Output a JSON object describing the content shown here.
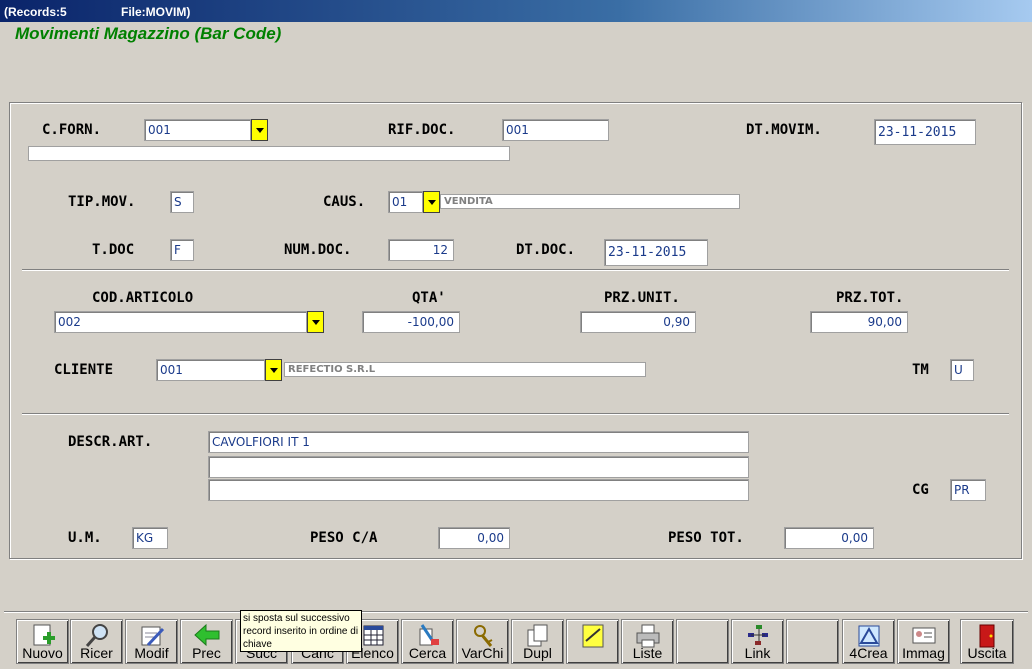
{
  "titlebar": {
    "records": "(Records:5",
    "file": "File:MOVIM)"
  },
  "form": {
    "title": "Movimenti Magazzino (Bar Code)"
  },
  "fields": {
    "c_forn": {
      "label": "C.FORN.",
      "value": "001",
      "desc": ""
    },
    "rif_doc": {
      "label": "RIF.DOC.",
      "value": "001"
    },
    "dt_movim": {
      "label": "DT.MOVIM.",
      "value": "23-11-2015"
    },
    "tip_mov": {
      "label": "TIP.MOV.",
      "value": "S"
    },
    "caus": {
      "label": "CAUS.",
      "value": "01",
      "desc": "VENDITA"
    },
    "t_doc": {
      "label": "T.DOC",
      "value": "F"
    },
    "num_doc": {
      "label": "NUM.DOC.",
      "value": "12"
    },
    "dt_doc": {
      "label": "DT.DOC.",
      "value": "23-11-2015"
    },
    "cod_articolo": {
      "label": "COD.ARTICOLO",
      "value": "002"
    },
    "qta": {
      "label": "QTA'",
      "value": "-100,00"
    },
    "prz_unit": {
      "label": "PRZ.UNIT.",
      "value": "0,90"
    },
    "prz_tot": {
      "label": "PRZ.TOT.",
      "value": "90,00"
    },
    "cliente": {
      "label": "CLIENTE",
      "value": "001",
      "desc": "REFECTIO S.R.L"
    },
    "tm": {
      "label": "TM",
      "value": "U"
    },
    "descr_art": {
      "label": "DESCR.ART.",
      "line1": "CAVOLFIORI IT 1",
      "line2": "",
      "line3": ""
    },
    "cg": {
      "label": "CG",
      "value": "PR"
    },
    "um": {
      "label": "U.M.",
      "value": "KG"
    },
    "peso_ca": {
      "label": "PESO C/A",
      "value": "0,00"
    },
    "peso_tot": {
      "label": "PESO TOT.",
      "value": "0,00"
    }
  },
  "toolbar": {
    "nuovo": "Nuovo",
    "ricer": "Ricer",
    "modif": "Modif",
    "prec": "Prec",
    "succ": "Succ",
    "canc": "Canc",
    "elenco": "Elenco",
    "cerca": "Cerca",
    "varchi": "VarChi",
    "dupl": "Dupl",
    "liste": "Liste",
    "link": "Link",
    "crea": "4Crea",
    "immag": "Immag",
    "uscita": "Uscita"
  },
  "tooltip": {
    "text": "si sposta sul successivo record inserito in ordine di chiave"
  },
  "colors": {
    "title_green": "#008000",
    "dropdown_yellow": "#ffff00",
    "value_blue": "#1a3a8a",
    "background": "#d4d0c8"
  }
}
